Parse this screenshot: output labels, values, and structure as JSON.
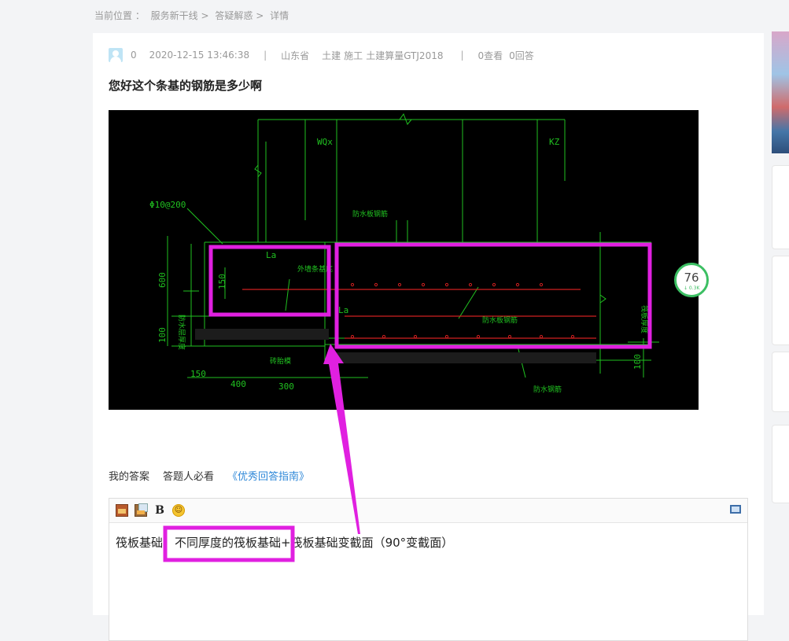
{
  "breadcrumb": {
    "prefix": "当前位置 ：",
    "items": [
      "服务新干线",
      "答疑解惑",
      "详情"
    ],
    "separator": ">"
  },
  "question": {
    "user_count": "0",
    "datetime": "2020-12-15 13:46:38",
    "region": "山东省",
    "tags": [
      "土建",
      "施工",
      "土建算量GTJ2018"
    ],
    "views": "0查看",
    "answers": "0回答",
    "title": "您好这个条基的钢筋是多少啊"
  },
  "drawing": {
    "labels": {
      "wo": "WQx",
      "kz": "KZ",
      "rebar": "Φ10@200",
      "la1": "La",
      "la2": "La",
      "dim_600": "600",
      "dim_150": "150",
      "dim_100a": "100",
      "dim_100b": "100",
      "w150": "150",
      "w400": "400",
      "w300": "300",
      "note1": "防水板钢筋",
      "note2": "外墙条基底",
      "note3": "防水板钢筋",
      "note4": "防水钢筋",
      "note5": "砖胎模",
      "note6": "筏板厚度",
      "note7": "防水层厚度"
    }
  },
  "answer_tabs": {
    "my_answer": "我的答案",
    "must_read": "答题人必看",
    "guide": "《优秀回答指南》"
  },
  "editor": {
    "tools": [
      "image-icon",
      "image-gallery-icon",
      "bold-icon",
      "emoji-icon",
      "fullscreen-icon"
    ],
    "bold_label": "B",
    "emoji_glyph": "☺",
    "part1": "筏板基础",
    "part2": "，不同厚度的筏板基础",
    "part3": "+筏板基础变截面（90°变截面）"
  },
  "score_badge": {
    "value": "76",
    "sub": "↓ 0.3K"
  },
  "colors": {
    "highlight": "#e020e0",
    "cad_line": "#20c020",
    "link": "#2f88d8"
  }
}
